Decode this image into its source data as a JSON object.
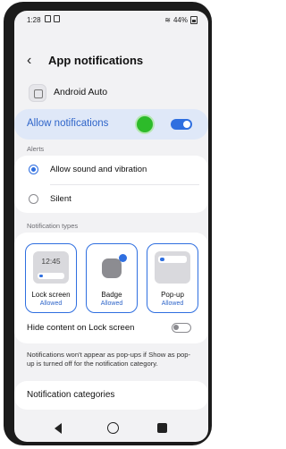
{
  "status_bar": {
    "time": "1:28",
    "battery": "44%"
  },
  "header": {
    "title": "App notifications"
  },
  "app": {
    "name": "Android Auto"
  },
  "allow": {
    "label": "Allow notifications",
    "enabled": true
  },
  "alerts": {
    "section_label": "Alerts",
    "options": [
      "Allow sound and vibration",
      "Silent"
    ],
    "selected": "Allow sound and vibration"
  },
  "types": {
    "section_label": "Notification types",
    "tiles": [
      {
        "label": "Lock screen",
        "status": "Allowed",
        "preview_time": "12:45"
      },
      {
        "label": "Badge",
        "status": "Allowed"
      },
      {
        "label": "Pop-up",
        "status": "Allowed"
      }
    ],
    "hide_content_label": "Hide content on Lock screen",
    "hide_content_enabled": false
  },
  "info": {
    "text": "Notifications won't appear as pop-ups if Show as pop-up is turned off for the notification category."
  },
  "categories": {
    "label": "Notification categories"
  },
  "colors": {
    "accent": "#2f6fe0",
    "allow_bg": "#dfe8f8",
    "touch_dot": "#2dbb2a"
  }
}
